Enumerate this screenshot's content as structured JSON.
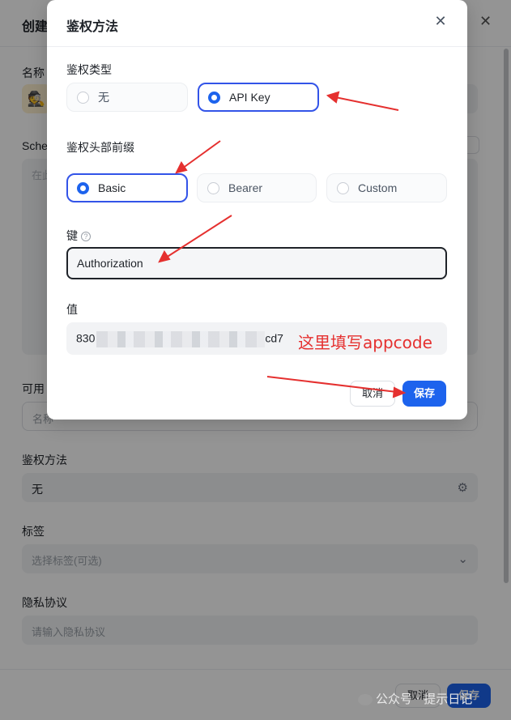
{
  "background": {
    "title": "创建",
    "name_label": "名称",
    "schema_label": "Sche",
    "schema_placeholder": "在此",
    "available_label": "可用",
    "available_field": "名称",
    "auth_label": "鉴权方法",
    "auth_value": "无",
    "tags_label": "标签",
    "tags_placeholder": "选择标签(可选)",
    "privacy_label": "隐私协议",
    "privacy_placeholder": "请输入隐私协议",
    "cancel": "取消",
    "save": "保存"
  },
  "modal": {
    "title": "鉴权方法",
    "auth_type": {
      "label": "鉴权类型",
      "options": [
        "无",
        "API Key"
      ],
      "selected": "API Key"
    },
    "header_prefix": {
      "label": "鉴权头部前缀",
      "options": [
        "Basic",
        "Bearer",
        "Custom"
      ],
      "selected": "Basic"
    },
    "key": {
      "label": "键",
      "value": "Authorization"
    },
    "value": {
      "label": "值",
      "prefix": "830",
      "suffix": "cd7"
    },
    "cancel": "取消",
    "save": "保存"
  },
  "annotation": "这里填写appcode",
  "watermark": "公众号 · 提示日记",
  "colors": {
    "accent": "#1d63ed",
    "selected_border": "#3354e8",
    "annotation": "#e5302f"
  }
}
